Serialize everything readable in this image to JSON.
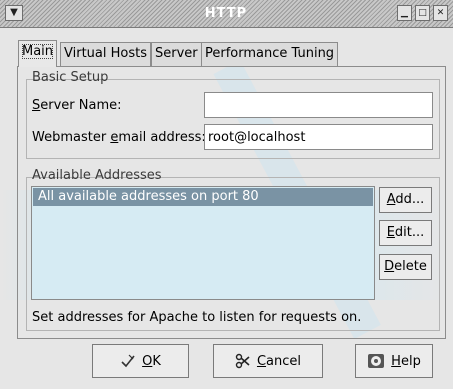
{
  "window": {
    "title": "HTTP",
    "menu_icon": "chevron-down-icon",
    "controls": [
      "minimize-icon",
      "maximize-icon",
      "close-icon"
    ]
  },
  "tabs": [
    {
      "label": "Main",
      "active": true
    },
    {
      "label": "Virtual Hosts",
      "active": false
    },
    {
      "label": "Server",
      "active": false
    },
    {
      "label": "Performance Tuning",
      "active": false
    }
  ],
  "basic_setup": {
    "title": "Basic Setup",
    "server_name_label_pre": "",
    "server_name_label_u": "S",
    "server_name_label_post": "erver Name:",
    "server_name_value": "",
    "email_label_pre": "Webmaster ",
    "email_label_u": "e",
    "email_label_post": "mail address:",
    "email_value": "root@localhost"
  },
  "addresses": {
    "title": "Available Addresses",
    "items": [
      "All available addresses on port 80"
    ],
    "add_label_u": "A",
    "add_label_post": "dd...",
    "edit_label_u": "E",
    "edit_label_post": "dit...",
    "delete_label_u": "D",
    "delete_label_post": "elete",
    "hint": "Set addresses for Apache to listen for requests on."
  },
  "buttons": {
    "ok_u": "O",
    "ok_post": "K",
    "cancel_u": "C",
    "cancel_post": "ancel",
    "help_u": "H",
    "help_post": "elp"
  }
}
